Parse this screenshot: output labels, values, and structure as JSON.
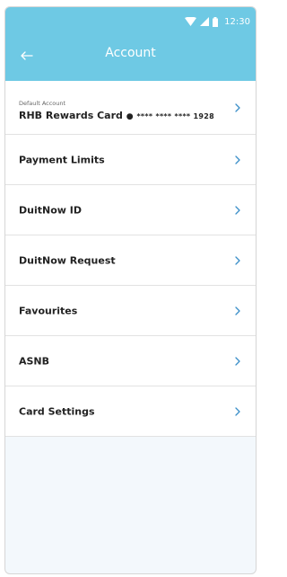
{
  "status_bar": {
    "time": "12:30",
    "icons": [
      "wifi-icon",
      "signal-icon",
      "battery-icon"
    ]
  },
  "header": {
    "title": "Account",
    "back_icon": "arrow-left-icon"
  },
  "default_account": {
    "caption": "Default Account",
    "name": "RHB Rewards Card",
    "separator": "●",
    "masked_number": "**** **** **** 1928"
  },
  "menu": [
    {
      "label": "Payment Limits"
    },
    {
      "label": "DuitNow ID"
    },
    {
      "label": "DuitNow Request"
    },
    {
      "label": "Favourites"
    },
    {
      "label": "ASNB"
    },
    {
      "label": "Card Settings"
    }
  ],
  "colors": {
    "header": "#6ec9e4",
    "chevron": "#3b8fc9",
    "background": "#f3f8fc"
  }
}
